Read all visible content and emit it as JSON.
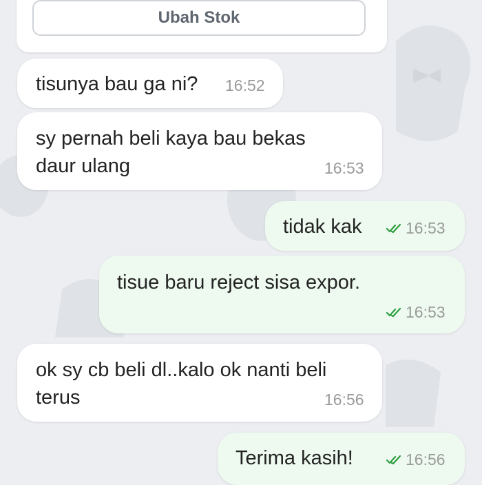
{
  "product_card": {
    "button_label": "Ubah Stok"
  },
  "messages": [
    {
      "text": "tisunya bau ga ni?",
      "time": "16:52",
      "direction": "incoming"
    },
    {
      "text_line1": "sy pernah beli kaya bau bekas",
      "text_line2": "daur ulang",
      "time": "16:53",
      "direction": "incoming"
    },
    {
      "text": "tidak kak",
      "time": "16:53",
      "direction": "outgoing",
      "status": "read"
    },
    {
      "text": "tisue baru reject sisa expor.",
      "time": "16:53",
      "direction": "outgoing",
      "status": "read"
    },
    {
      "text_line1": "ok sy cb beli dl..kalo ok nanti beli",
      "text_line2": "terus",
      "time": "16:56",
      "direction": "incoming"
    },
    {
      "text": "Terima kasih!",
      "time": "16:56",
      "direction": "outgoing",
      "status": "read"
    }
  ],
  "colors": {
    "read_tick": "#2e9e3f",
    "outgoing_bubble": "#eefaf0",
    "incoming_bubble": "#ffffff",
    "background": "#eceef2"
  },
  "icons": {
    "read_status": "double-check-icon"
  }
}
